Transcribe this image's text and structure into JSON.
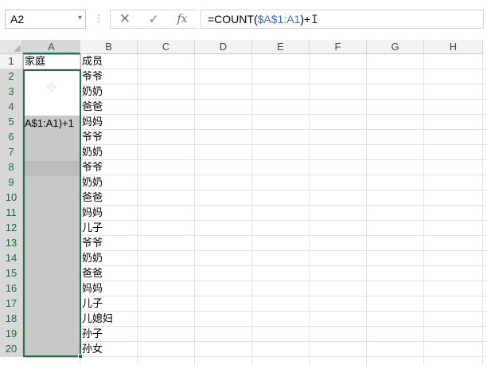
{
  "formula_bar": {
    "name_box": "A2",
    "name_box_arrow": "▾",
    "dots": "⋮",
    "cancel_glyph": "✕",
    "enter_glyph": "✓",
    "fx_glyph": "fx",
    "formula_prefix": "=COUNT(",
    "formula_ref": "$A$1:A1",
    "formula_suffix": ")+",
    "cursor_glyph": "I"
  },
  "columns": [
    "A",
    "B",
    "C",
    "D",
    "E",
    "F",
    "G",
    "H"
  ],
  "active_column": "A",
  "rows": [
    "1",
    "2",
    "3",
    "4",
    "5",
    "6",
    "7",
    "8",
    "9",
    "10",
    "11",
    "12",
    "13",
    "14",
    "15",
    "16",
    "17",
    "18",
    "19",
    "20"
  ],
  "active_rows": [
    "2",
    "3",
    "4",
    "5",
    "6",
    "7",
    "8",
    "9",
    "10",
    "11",
    "12",
    "13",
    "14",
    "15",
    "16",
    "17",
    "18",
    "19",
    "20"
  ],
  "cells": {
    "A1": "家庭",
    "B1": "成员",
    "B2": "爷爷",
    "B3": "奶奶",
    "B4": "爸爸",
    "B5": "妈妈",
    "B6": "爷爷",
    "B7": "奶奶",
    "B8": "爷爷",
    "B9": "奶奶",
    "B10": "爸爸",
    "B11": "妈妈",
    "B12": "儿子",
    "B13": "爷爷",
    "B14": "奶奶",
    "B15": "爸爸",
    "B16": "妈妈",
    "B17": "儿子",
    "B18": "儿媳妇",
    "B19": "孙子",
    "B20": "孙女"
  },
  "editing_text": "A$1:A1)+1",
  "colors": {
    "selection_border": "#217346",
    "selection_fill": "#c8c8c8",
    "formula_reference": "#3c6fc6"
  }
}
